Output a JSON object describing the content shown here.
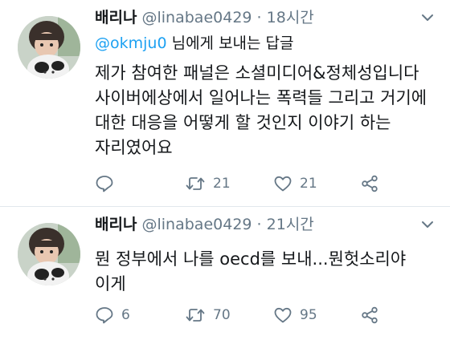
{
  "tweets": [
    {
      "display_name": "배리나",
      "handle": "@linabae0429",
      "separator": "·",
      "time": "18시간",
      "reply_to": {
        "mention": "@okmju0",
        "rest": " 님에게 보내는 답글"
      },
      "text_lines": [
        "제가 참여한 패널은 소셜미디어&정체성입니다",
        "사이버에상에서 일어나는 폭력들 그리고 거기에",
        "대한 대응을 어떻게 할 것인지 이야기 하는",
        "자리였어요"
      ],
      "actions": {
        "reply": "",
        "retweet": "21",
        "like": "21"
      }
    },
    {
      "display_name": "배리나",
      "handle": "@linabae0429",
      "separator": "·",
      "time": "21시간",
      "text_lines": [
        "뭔 정부에서 나를 oecd를 보내...뭔헛소리야",
        "이게"
      ],
      "actions": {
        "reply": "6",
        "retweet": "70",
        "like": "95"
      }
    }
  ],
  "colors": {
    "text": "#14171a",
    "secondary": "#657786",
    "link": "#1da1f2",
    "divider": "#e1e8ed"
  },
  "icons": [
    "chevron-down-icon",
    "reply-icon",
    "retweet-icon",
    "like-icon",
    "share-icon"
  ]
}
